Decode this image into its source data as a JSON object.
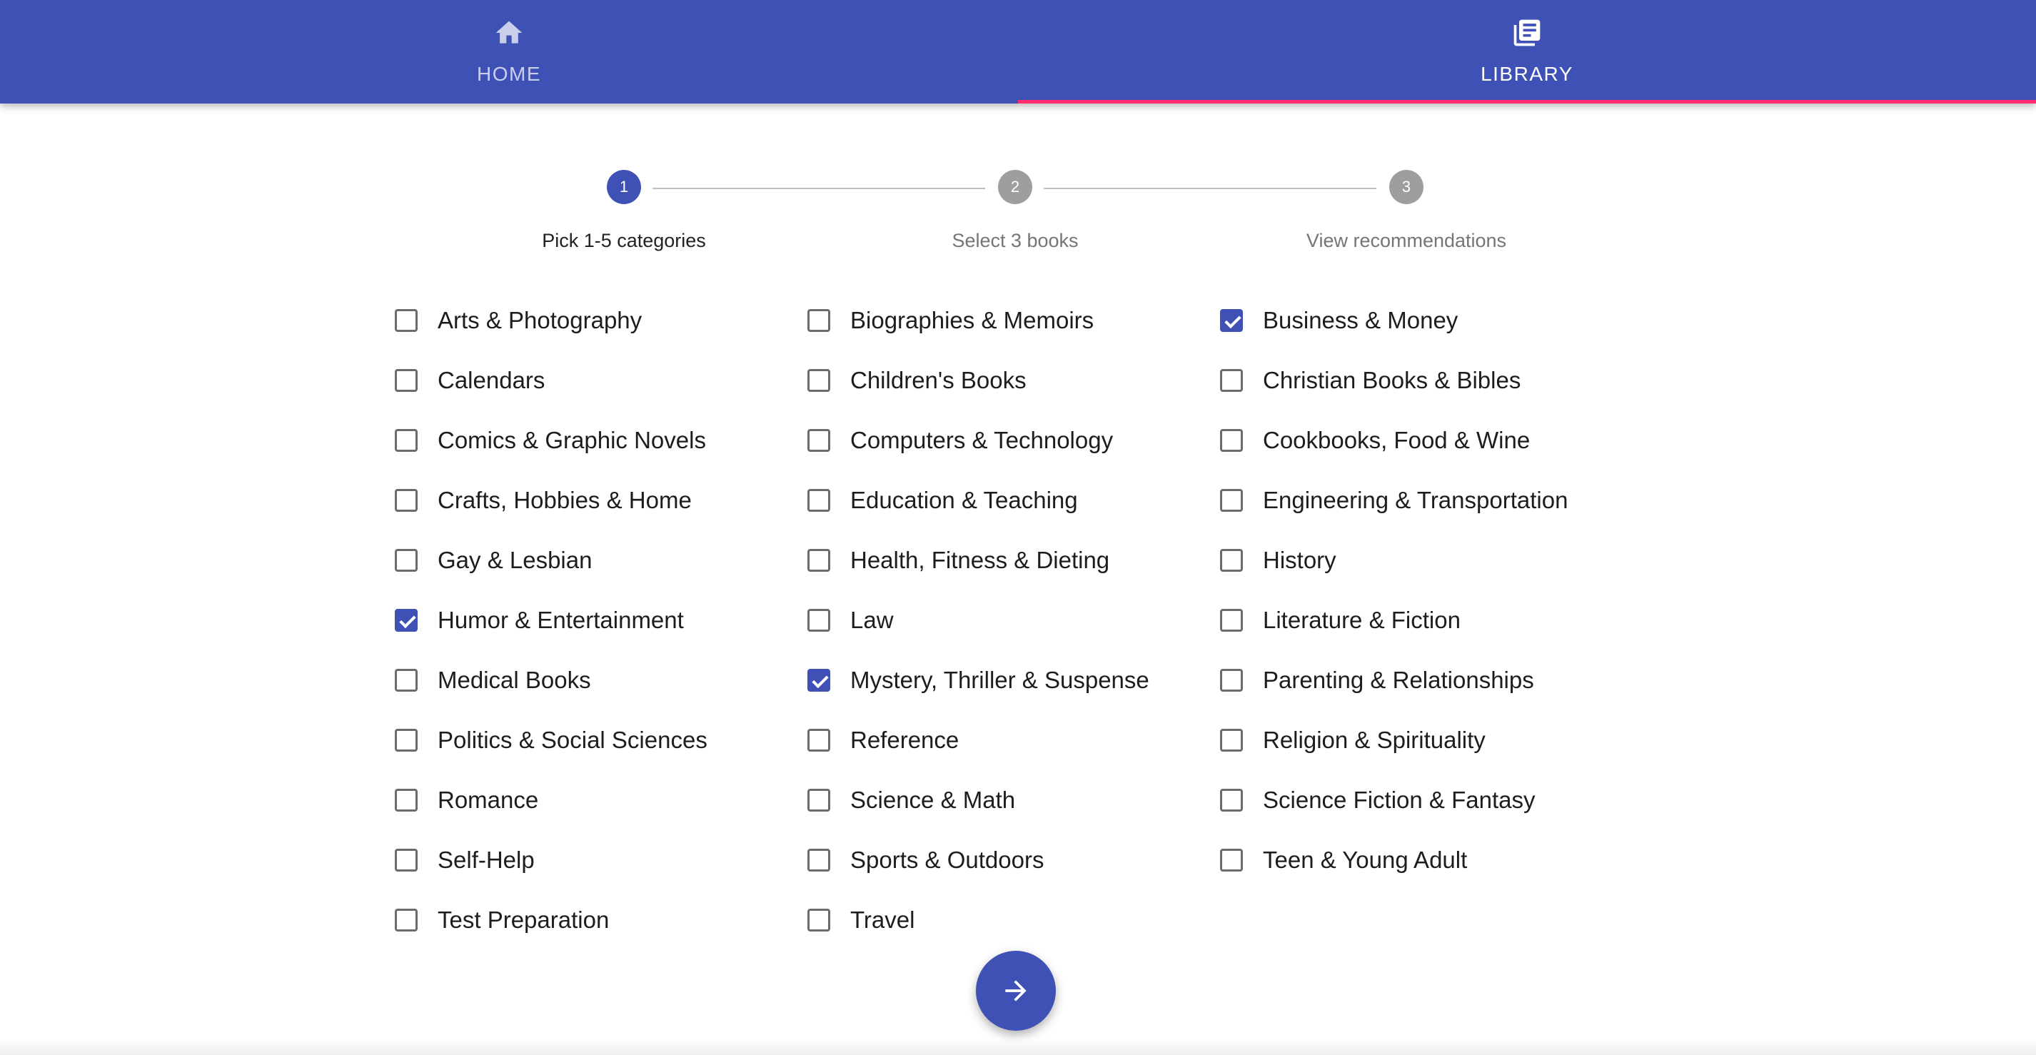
{
  "tabs": [
    {
      "label": "HOME",
      "icon": "home-icon",
      "selected": false
    },
    {
      "label": "LIBRARY",
      "icon": "library-books-icon",
      "selected": true
    }
  ],
  "colors": {
    "primary": "#3f51b5",
    "indicator": "#ff2d6f",
    "inactive_step": "#9e9e9e"
  },
  "stepper": {
    "steps": [
      {
        "number": "1",
        "label": "Pick 1-5 categories",
        "active": true
      },
      {
        "number": "2",
        "label": "Select 3 books",
        "active": false
      },
      {
        "number": "3",
        "label": "View recommendations",
        "active": false
      }
    ]
  },
  "categories": {
    "columns": [
      [
        {
          "label": "Arts & Photography",
          "checked": false
        },
        {
          "label": "Calendars",
          "checked": false
        },
        {
          "label": "Comics & Graphic Novels",
          "checked": false
        },
        {
          "label": "Crafts, Hobbies & Home",
          "checked": false
        },
        {
          "label": "Gay & Lesbian",
          "checked": false
        },
        {
          "label": "Humor & Entertainment",
          "checked": true
        },
        {
          "label": "Medical Books",
          "checked": false
        },
        {
          "label": "Politics & Social Sciences",
          "checked": false
        },
        {
          "label": "Romance",
          "checked": false
        },
        {
          "label": "Self-Help",
          "checked": false
        },
        {
          "label": "Test Preparation",
          "checked": false
        }
      ],
      [
        {
          "label": "Biographies & Memoirs",
          "checked": false
        },
        {
          "label": "Children's Books",
          "checked": false
        },
        {
          "label": "Computers & Technology",
          "checked": false
        },
        {
          "label": "Education & Teaching",
          "checked": false
        },
        {
          "label": "Health, Fitness & Dieting",
          "checked": false
        },
        {
          "label": "Law",
          "checked": false
        },
        {
          "label": "Mystery, Thriller & Suspense",
          "checked": true
        },
        {
          "label": "Reference",
          "checked": false
        },
        {
          "label": "Science & Math",
          "checked": false
        },
        {
          "label": "Sports & Outdoors",
          "checked": false
        },
        {
          "label": "Travel",
          "checked": false
        }
      ],
      [
        {
          "label": "Business & Money",
          "checked": true
        },
        {
          "label": "Christian Books & Bibles",
          "checked": false
        },
        {
          "label": "Cookbooks, Food & Wine",
          "checked": false
        },
        {
          "label": "Engineering & Transportation",
          "checked": false
        },
        {
          "label": "History",
          "checked": false
        },
        {
          "label": "Literature & Fiction",
          "checked": false
        },
        {
          "label": "Parenting & Relationships",
          "checked": false
        },
        {
          "label": "Religion & Spirituality",
          "checked": false
        },
        {
          "label": "Science Fiction & Fantasy",
          "checked": false
        },
        {
          "label": "Teen & Young Adult",
          "checked": false
        }
      ]
    ]
  },
  "next_button": {
    "icon": "arrow-forward-icon"
  }
}
